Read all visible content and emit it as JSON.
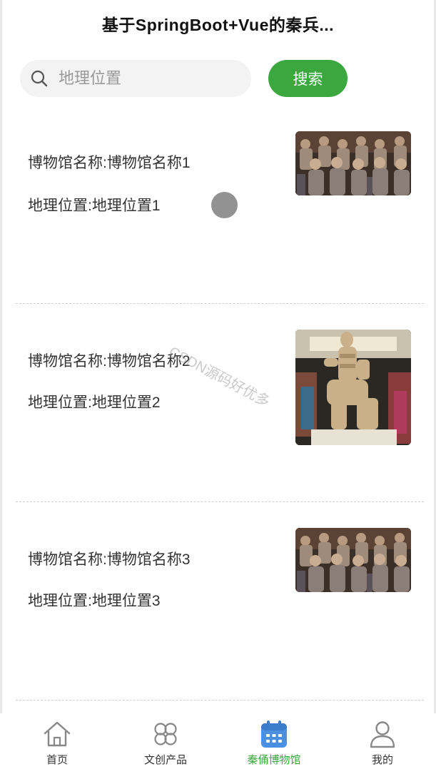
{
  "header": {
    "title": "基于SpringBoot+Vue的秦兵..."
  },
  "search": {
    "placeholder": "地理位置",
    "button_label": "搜索"
  },
  "items": [
    {
      "name_line": "博物馆名称:博物馆名称1",
      "location_line": "地理位置:地理位置1",
      "image": "terracotta-warriors-row"
    },
    {
      "name_line": "博物馆名称:博物馆名称2",
      "location_line": "地理位置:地理位置2",
      "image": "kneeling-archer-statue"
    },
    {
      "name_line": "博物馆名称:博物馆名称3",
      "location_line": "地理位置:地理位置3",
      "image": "terracotta-warriors-row"
    }
  ],
  "watermark": "CSDN源码好优多",
  "tabbar": {
    "tabs": [
      {
        "label": "首页",
        "icon": "home-icon",
        "active": false
      },
      {
        "label": "文创产品",
        "icon": "grid-clover-icon",
        "active": false
      },
      {
        "label": "秦俑博物馆",
        "icon": "calendar-icon",
        "active": true
      },
      {
        "label": "我的",
        "icon": "user-icon",
        "active": false
      }
    ]
  },
  "colors": {
    "accent": "#3aa83f",
    "active_icon": "#4a90e2",
    "inactive_icon": "#888888"
  }
}
